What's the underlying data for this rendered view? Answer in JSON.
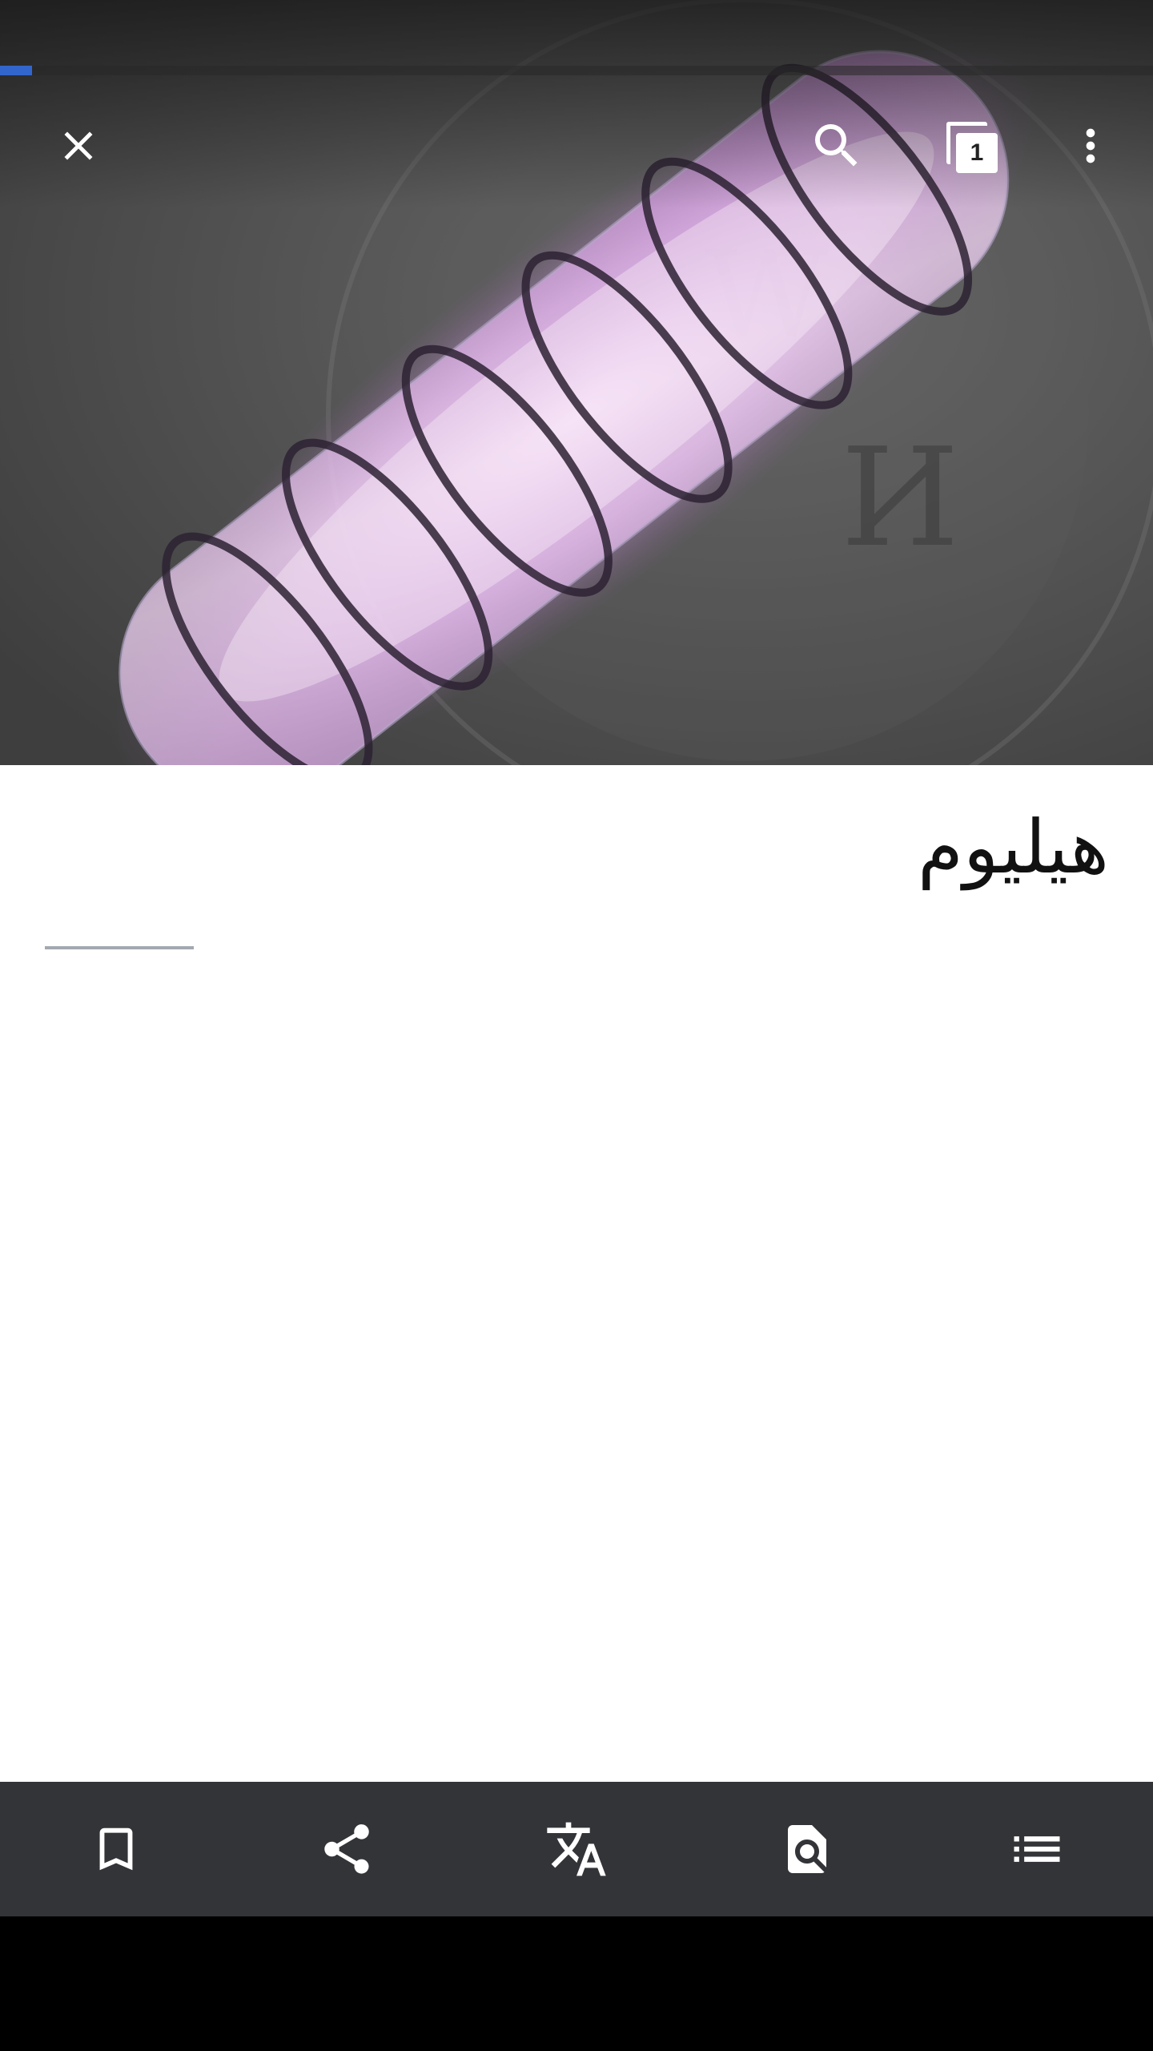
{
  "article": {
    "title": "هيليوم"
  },
  "page_load_progress": 0.028,
  "toolbar": {
    "close_icon": "close-icon",
    "search_icon": "search-icon",
    "tabs_icon": "tabs-icon",
    "tab_count": "1",
    "overflow_icon": "more-vert-icon"
  },
  "bottom_bar": {
    "items": [
      "bookmark-icon",
      "share-icon",
      "translate-icon",
      "find-in-page-icon",
      "table-of-contents-icon"
    ]
  },
  "colors": {
    "progress": "#3366cc",
    "toolbar_bg": "#333438",
    "article_bg": "#ffffff",
    "glow": "#e6b8f0"
  }
}
